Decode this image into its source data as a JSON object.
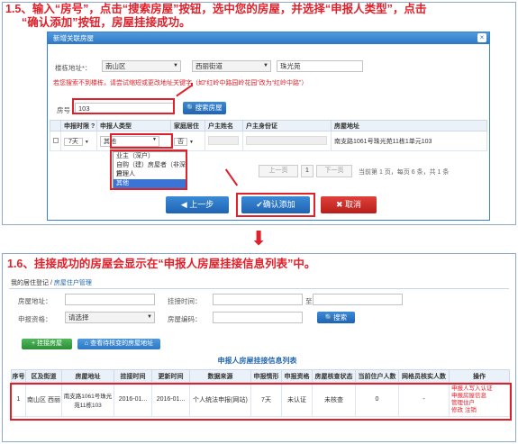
{
  "step1": {
    "title_line1": "1.5、输入“房号”，点击“搜索房屋”按钮，选中您的房屋，并选择“申报人类型”，点击",
    "title_line2": "“确认添加”按钮，房屋挂接成功。"
  },
  "dialog": {
    "title": "新增关联房屋",
    "close": "×",
    "building_label": "楼栋地址*：",
    "district": "南山区",
    "street": "西丽街道",
    "community": "珠光苑",
    "warning": "若您搜索不到楼栋，请尝试缩短或更改地址关键字（如“红岭中路园岭花园”改为“红岭中路”）",
    "room_label": "房号",
    "room_value": "103",
    "search_button": "搜索房屋",
    "table_headers": [
      "",
      "申报时限 ?",
      "申报人类型",
      "家庭居住",
      "户主姓名",
      "户主身份证",
      "房屋地址"
    ],
    "row": {
      "period": "7天",
      "applicant_type": "其他",
      "family": "否",
      "address": "南支路1061号珠光苑11栋1单元103"
    },
    "dropdown_options": [
      "业主（深户）",
      "自购（建）房屋者（非深户）",
      "管理人",
      "其他"
    ],
    "pager": {
      "prev": "上一页",
      "page": "1",
      "next": "下一页",
      "summary": "当前第  1  页，每页  6  条，共 1 条"
    },
    "back_button": "上一步",
    "confirm_button": "确认添加",
    "cancel_button": "取消"
  },
  "arrow_down": "⬇",
  "step2": {
    "title": "1.6、挂接成功的房屋会显示在“申报人房屋挂接信息列表”中。"
  },
  "bottom": {
    "tabs": [
      "我的居住登记",
      "房屋住户管理"
    ],
    "house_addr_label": "房屋地址：",
    "time_label": "挂接时间：",
    "to_label": "至",
    "qual_label": "申报资格：",
    "qual_value": "请选择",
    "room_label": "房屋编码：",
    "search_button": "搜索",
    "add_house_button": "挂接房屋",
    "view_button": "查看待核变的房屋地址",
    "list_title": "申报人房屋挂接信息列表",
    "table_headers": [
      "序号",
      "区及街道",
      "房屋地址",
      "挂接时间",
      "更新时间",
      "数据来源",
      "申报情形",
      "申报资格",
      "房屋核查状态",
      "当前住户人数",
      "网格员核实人数",
      "操作"
    ],
    "row": {
      "index": "1",
      "district": "南山区 西丽",
      "address": "南支路1061号珠光苑11栋103",
      "link_time": "2016-01...",
      "update_time": "2016-01...",
      "source": "个人统法申报(网站)",
      "period": "7天",
      "qualification": "未认证",
      "status": "未核查",
      "residents": "0",
      "verified": "-",
      "actions": [
        "申报人",
        "写入认证",
        "申报房屋信息",
        "管理住户",
        "修改",
        "注销"
      ]
    }
  },
  "colors": {
    "accent_red": "#e0202a",
    "primary_blue": "#2e77c4",
    "green": "#2d8d38"
  }
}
